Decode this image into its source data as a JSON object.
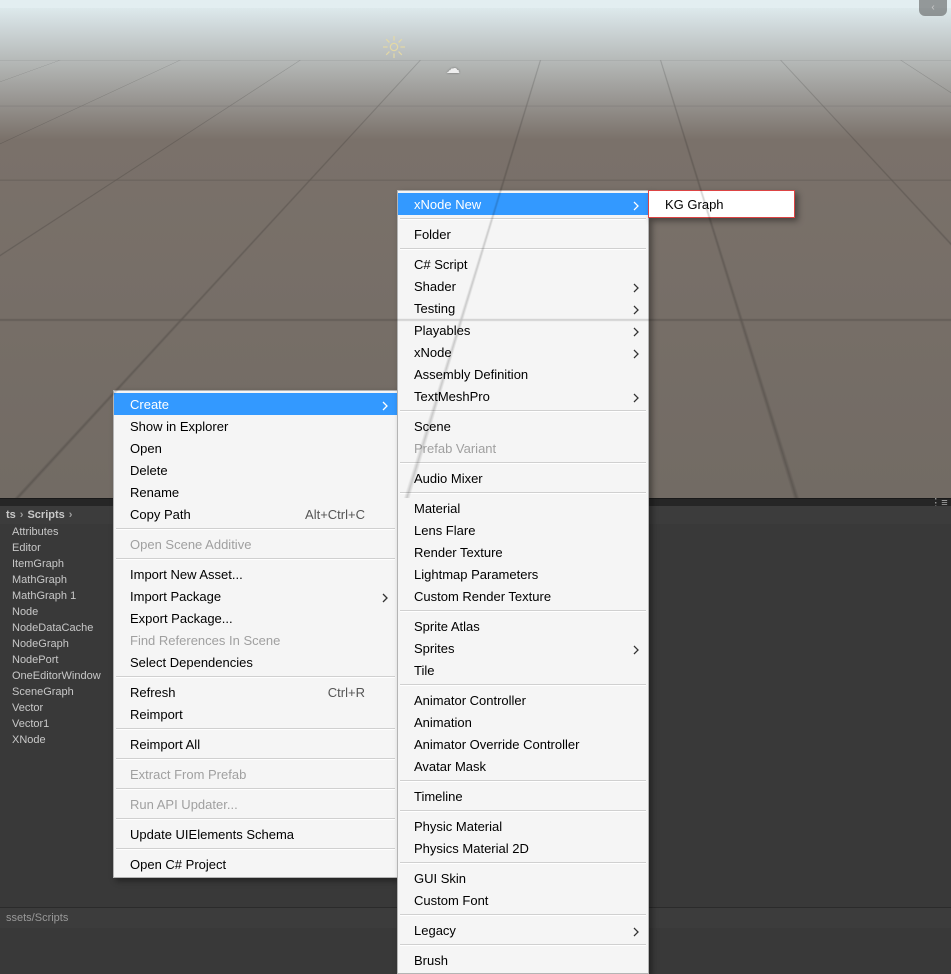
{
  "breadcrumb": {
    "part1": "ts",
    "part2": "Scripts"
  },
  "status_path": "ssets/Scripts",
  "project_files": [
    "Attributes",
    "Editor",
    "ItemGraph",
    "MathGraph",
    "MathGraph 1",
    "Node",
    "NodeDataCache",
    "NodeGraph",
    "NodePort",
    "OneEditorWindow",
    "SceneGraph",
    "Vector",
    "Vector1",
    "XNode"
  ],
  "gizmo_handle": "‹",
  "context_menu": {
    "items": [
      {
        "label": "Create",
        "submenu": true,
        "hover": true
      },
      {
        "label": "Show in Explorer"
      },
      {
        "label": "Open"
      },
      {
        "label": "Delete"
      },
      {
        "label": "Rename"
      },
      {
        "label": "Copy Path",
        "shortcut": "Alt+Ctrl+C"
      },
      {
        "sep": true
      },
      {
        "label": "Open Scene Additive",
        "disabled": true
      },
      {
        "sep": true
      },
      {
        "label": "Import New Asset..."
      },
      {
        "label": "Import Package",
        "submenu": true
      },
      {
        "label": "Export Package..."
      },
      {
        "label": "Find References In Scene",
        "disabled": true
      },
      {
        "label": "Select Dependencies"
      },
      {
        "sep": true
      },
      {
        "label": "Refresh",
        "shortcut": "Ctrl+R"
      },
      {
        "label": "Reimport"
      },
      {
        "sep": true
      },
      {
        "label": "Reimport All"
      },
      {
        "sep": true
      },
      {
        "label": "Extract From Prefab",
        "disabled": true
      },
      {
        "sep": true
      },
      {
        "label": "Run API Updater...",
        "disabled": true
      },
      {
        "sep": true
      },
      {
        "label": "Update UIElements Schema"
      },
      {
        "sep": true
      },
      {
        "label": "Open C# Project"
      }
    ]
  },
  "create_menu": {
    "items": [
      {
        "label": "xNode New",
        "submenu": true,
        "hover": true
      },
      {
        "sep": true
      },
      {
        "label": "Folder"
      },
      {
        "sep": true
      },
      {
        "label": "C# Script"
      },
      {
        "label": "Shader",
        "submenu": true
      },
      {
        "label": "Testing",
        "submenu": true
      },
      {
        "label": "Playables",
        "submenu": true
      },
      {
        "label": "xNode",
        "submenu": true
      },
      {
        "label": "Assembly Definition"
      },
      {
        "label": "TextMeshPro",
        "submenu": true
      },
      {
        "sep": true
      },
      {
        "label": "Scene"
      },
      {
        "label": "Prefab Variant",
        "disabled": true
      },
      {
        "sep": true
      },
      {
        "label": "Audio Mixer"
      },
      {
        "sep": true
      },
      {
        "label": "Material"
      },
      {
        "label": "Lens Flare"
      },
      {
        "label": "Render Texture"
      },
      {
        "label": "Lightmap Parameters"
      },
      {
        "label": "Custom Render Texture"
      },
      {
        "sep": true
      },
      {
        "label": "Sprite Atlas"
      },
      {
        "label": "Sprites",
        "submenu": true
      },
      {
        "label": "Tile"
      },
      {
        "sep": true
      },
      {
        "label": "Animator Controller"
      },
      {
        "label": "Animation"
      },
      {
        "label": "Animator Override Controller"
      },
      {
        "label": "Avatar Mask"
      },
      {
        "sep": true
      },
      {
        "label": "Timeline"
      },
      {
        "sep": true
      },
      {
        "label": "Physic Material"
      },
      {
        "label": "Physics Material 2D"
      },
      {
        "sep": true
      },
      {
        "label": "GUI Skin"
      },
      {
        "label": "Custom Font"
      },
      {
        "sep": true
      },
      {
        "label": "Legacy",
        "submenu": true
      },
      {
        "sep": true
      },
      {
        "label": "Brush"
      }
    ]
  },
  "xnode_new_menu": {
    "items": [
      {
        "label": "KG Graph"
      }
    ]
  }
}
